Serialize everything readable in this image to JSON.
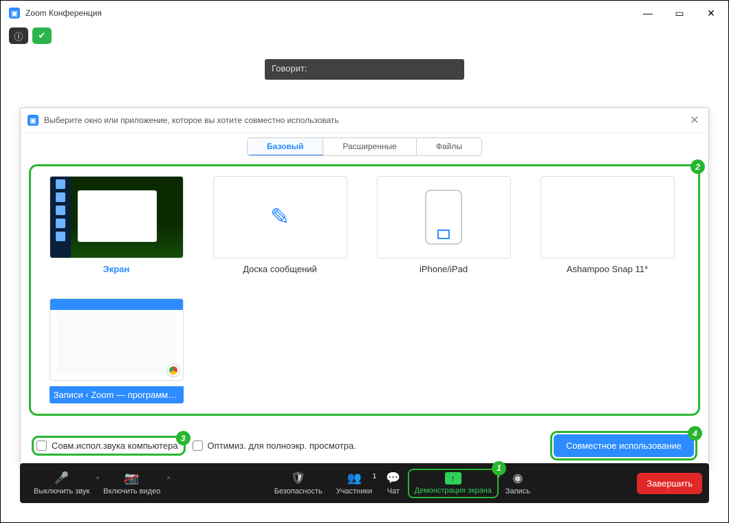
{
  "window": {
    "title": "Zoom Конференция"
  },
  "speaking": "Говорит:",
  "dialog": {
    "title": "Выберите окно или приложение, которое вы хотите совместно использовать",
    "tabs": {
      "basic": "Базовый",
      "advanced": "Расширенные",
      "files": "Файлы"
    },
    "tiles": {
      "screen": "Экран",
      "whiteboard": "Доска сообщений",
      "iphone": "iPhone/iPad",
      "snap": "Ashampoo Snap 11*",
      "browser": "Записи ‹ Zoom — программа д..."
    },
    "checks": {
      "audio": "Совм.испол.звука компьютера",
      "optimize": "Оптимиз. для полноэкр. просмотра."
    },
    "share_btn": "Совместное использование"
  },
  "toolbar": {
    "mute": "Выключить звук",
    "video": "Включить видео",
    "security": "Безопасность",
    "participants": "Участники",
    "participants_count": "1",
    "chat": "Чат",
    "share": "Демонстрация экрана",
    "record": "Запись",
    "end": "Завершить"
  },
  "callouts": {
    "c1": "1",
    "c2": "2",
    "c3": "3",
    "c4": "4"
  }
}
